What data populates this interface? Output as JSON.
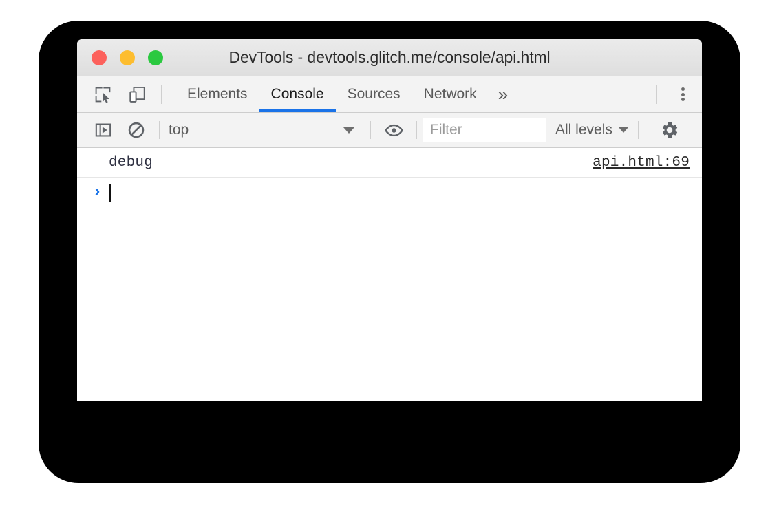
{
  "window": {
    "title": "DevTools - devtools.glitch.me/console/api.html",
    "traffic_lights": [
      {
        "name": "close",
        "color": "#fc615c"
      },
      {
        "name": "minimize",
        "color": "#fdbd2f"
      },
      {
        "name": "zoom",
        "color": "#2bc940"
      }
    ]
  },
  "tabbar": {
    "inspect_icon": "inspect-element-icon",
    "device_icon": "device-toolbar-icon",
    "tabs": [
      {
        "label": "Elements",
        "active": false
      },
      {
        "label": "Console",
        "active": true
      },
      {
        "label": "Sources",
        "active": false
      },
      {
        "label": "Network",
        "active": false
      }
    ],
    "more_tabs_label": "»",
    "kebab_icon": "more-options-icon",
    "active_tab_color": "#1a73e8"
  },
  "console_toolbar": {
    "sidebar_toggle_icon": "show-console-sidebar-icon",
    "clear_icon": "clear-console-icon",
    "context": {
      "label": "top",
      "caret": "▼"
    },
    "eye_icon": "create-live-expression-icon",
    "filter": {
      "value": "",
      "placeholder": "Filter"
    },
    "levels": {
      "label": "All levels",
      "caret": "▼"
    },
    "settings_icon": "console-settings-icon"
  },
  "console": {
    "messages": [
      {
        "text": "debug",
        "source_link": "api.html:69"
      }
    ],
    "prompt": {
      "caret": "›",
      "value": ""
    }
  }
}
